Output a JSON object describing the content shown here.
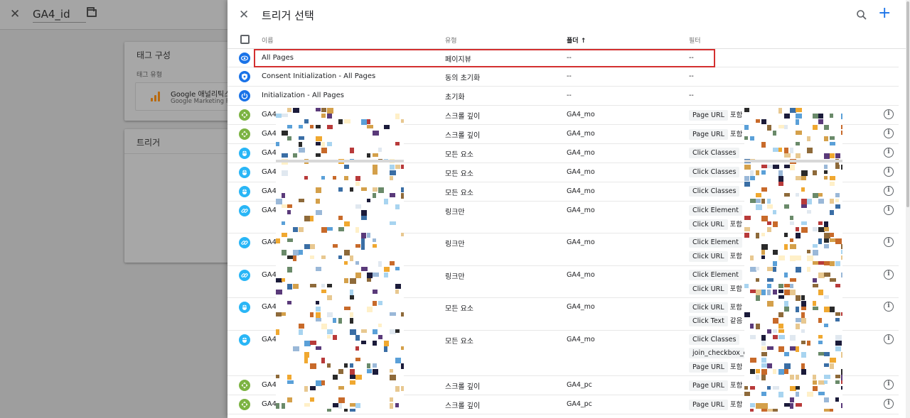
{
  "background": {
    "title": "GA4_id",
    "tag_config_title": "태그 구성",
    "tag_type_label": "태그 유형",
    "tag_name": "Google 애널리틱스",
    "tag_sub": "Google Marketing Pla",
    "trigger_title": "트리거"
  },
  "panel": {
    "title": "트리거 선택",
    "columns": {
      "name": "이름",
      "type": "유형",
      "folder": "폴더 ↑",
      "filter": "필터"
    }
  },
  "rows": [
    {
      "icon": "pageview",
      "color": "#1a73e8",
      "name": "All Pages",
      "type": "페이지뷰",
      "folder": "--",
      "filters": [
        {
          "chip": "--",
          "op": ""
        }
      ],
      "info": false
    },
    {
      "icon": "consent",
      "color": "#1a73e8",
      "name": "Consent Initialization - All Pages",
      "type": "동의 초기화",
      "folder": "--",
      "filters": [
        {
          "chip": "--",
          "op": ""
        }
      ],
      "info": false
    },
    {
      "icon": "init",
      "color": "#1a73e8",
      "name": "Initialization - All Pages",
      "type": "초기화",
      "folder": "--",
      "filters": [
        {
          "chip": "--",
          "op": ""
        }
      ],
      "info": false
    },
    {
      "icon": "scroll",
      "color": "#7cb342",
      "name": "GA4",
      "type": "스크롤 깊이",
      "folder": "GA4_mo",
      "filters": [
        {
          "chip": "Page URL",
          "op": "포함"
        }
      ],
      "info": true
    },
    {
      "icon": "scroll",
      "color": "#7cb342",
      "name": "GA4",
      "type": "스크롤 깊이",
      "folder": "GA4_mo",
      "filters": [
        {
          "chip": "Page URL",
          "op": "포함"
        }
      ],
      "info": true
    },
    {
      "icon": "click",
      "color": "#29b6f6",
      "name": "GA4",
      "type": "모든 요소",
      "folder": "GA4_mo",
      "filters": [
        {
          "chip": "Click Classes",
          "op": ""
        }
      ],
      "info": true
    },
    {
      "icon": "click",
      "color": "#29b6f6",
      "name": "GA4",
      "type": "모든 요소",
      "folder": "GA4_mo",
      "filters": [
        {
          "chip": "Click Classes",
          "op": ""
        }
      ],
      "info": true
    },
    {
      "icon": "click",
      "color": "#29b6f6",
      "name": "GA4",
      "type": "모든 요소",
      "folder": "GA4_mo",
      "filters": [
        {
          "chip": "Click Classes",
          "op": ""
        }
      ],
      "info": true
    },
    {
      "icon": "link",
      "color": "#29b6f6",
      "name": "GA4",
      "type": "링크만",
      "folder": "GA4_mo",
      "filters": [
        {
          "chip": "Click Element",
          "op": ""
        },
        {
          "chip": "Click URL",
          "op": "포함"
        }
      ],
      "info": true
    },
    {
      "icon": "link",
      "color": "#29b6f6",
      "name": "GA4",
      "type": "링크만",
      "folder": "GA4_mo",
      "filters": [
        {
          "chip": "Click Element",
          "op": ""
        },
        {
          "chip": "Click URL",
          "op": "포함"
        }
      ],
      "info": true
    },
    {
      "icon": "link",
      "color": "#29b6f6",
      "name": "GA4",
      "type": "링크만",
      "folder": "GA4_mo",
      "filters": [
        {
          "chip": "Click Element",
          "op": ""
        },
        {
          "chip": "Click URL",
          "op": "포함"
        }
      ],
      "info": true
    },
    {
      "icon": "click",
      "color": "#29b6f6",
      "name": "GA4",
      "type": "모든 요소",
      "folder": "GA4_mo",
      "filters": [
        {
          "chip": "Click URL",
          "op": "포함"
        },
        {
          "chip": "Click Text",
          "op": "같음"
        }
      ],
      "info": true
    },
    {
      "icon": "click",
      "color": "#29b6f6",
      "name": "GA4",
      "type": "모든 요소",
      "folder": "GA4_mo",
      "filters": [
        {
          "chip": "Click Classes",
          "op": ""
        },
        {
          "chip": "join_checkbox_cl",
          "op": ""
        },
        {
          "chip": "Page URL",
          "op": "포함"
        }
      ],
      "info": true
    },
    {
      "icon": "scroll",
      "color": "#7cb342",
      "name": "GA4",
      "type": "스크롤 깊이",
      "folder": "GA4_pc",
      "filters": [
        {
          "chip": "Page URL",
          "op": "포함"
        }
      ],
      "info": true
    },
    {
      "icon": "scroll",
      "color": "#7cb342",
      "name": "GA4",
      "type": "스크롤 깊이",
      "folder": "GA4_pc",
      "filters": [
        {
          "chip": "Page URL",
          "op": "포함"
        }
      ],
      "info": true
    }
  ]
}
